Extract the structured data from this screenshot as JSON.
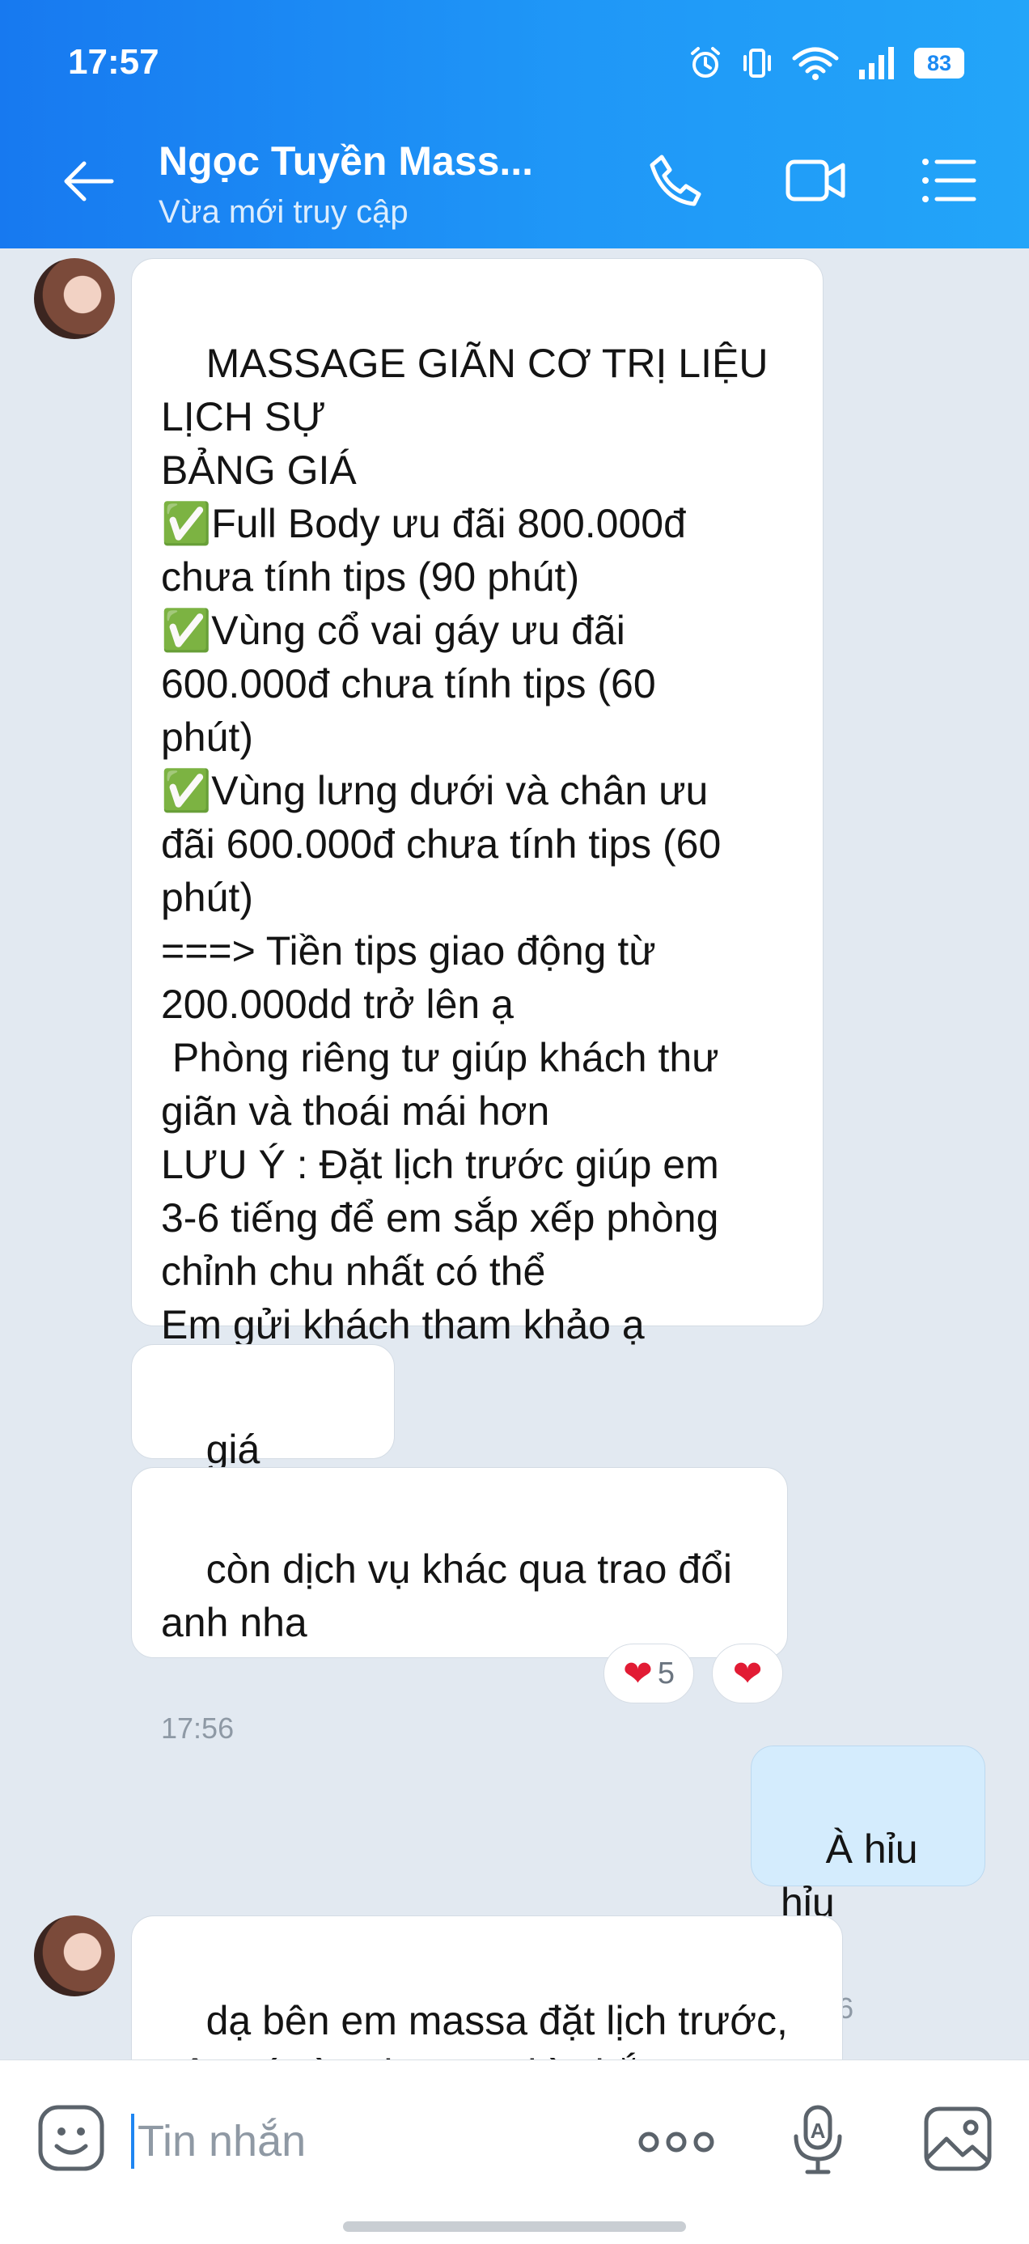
{
  "status": {
    "time": "17:57",
    "battery": "83"
  },
  "header": {
    "title": "Ngọc Tuyền Mass...",
    "subtitle": "Vừa mới truy cập",
    "icons": [
      "back-arrow-icon",
      "phone-icon",
      "video-call-icon",
      "menu-icon"
    ]
  },
  "messages": [
    {
      "sender": "contact",
      "text": "MASSAGE GIÃN CƠ TRỊ LIỆU\nLỊCH SỰ\nBẢNG GIÁ\n✅Full Body ưu đãi 800.000đ\nchưa tính tips (90 phút)\n✅Vùng cổ vai gáy ưu đãi\n600.000đ chưa tính tips (60\nphút)\n✅Vùng lưng dưới và chân ưu\nđãi 600.000đ chưa tính tips (60\nphút)\n===> Tiền tips giao động từ\n200.000dd trở lên ạ\n Phòng riêng tư giúp khách thư\ngiãn và thoái mái hơn\nLƯU Ý : Đặt lịch trước giúp em\n3-6 tiếng để em sắp xếp phòng\nchỉnh chu nhất có thể\nEm gửi khách tham khảo ạ"
    },
    {
      "sender": "contact",
      "text": "giá massa"
    },
    {
      "sender": "contact",
      "text": "còn dịch vụ khác qua trao đổi\nanh nha",
      "time": "17:56",
      "reaction": {
        "emoji": "❤",
        "count": "5"
      },
      "my_reaction": "❤"
    },
    {
      "sender": "me",
      "text": "À hỉu hỉu",
      "time": "17:56"
    },
    {
      "sender": "contact",
      "text": "dạ bên em massa đặt lịch trước,\nnên có gì anh sang thì nhắn em"
    }
  ],
  "input": {
    "placeholder": "Tin nhắn"
  },
  "colors": {
    "header_start": "#1779f0",
    "header_end": "#23a5f9",
    "my_bubble": "#d4ecfd",
    "chat_bg": "#e2e9f1",
    "heart": "#e21b34"
  }
}
